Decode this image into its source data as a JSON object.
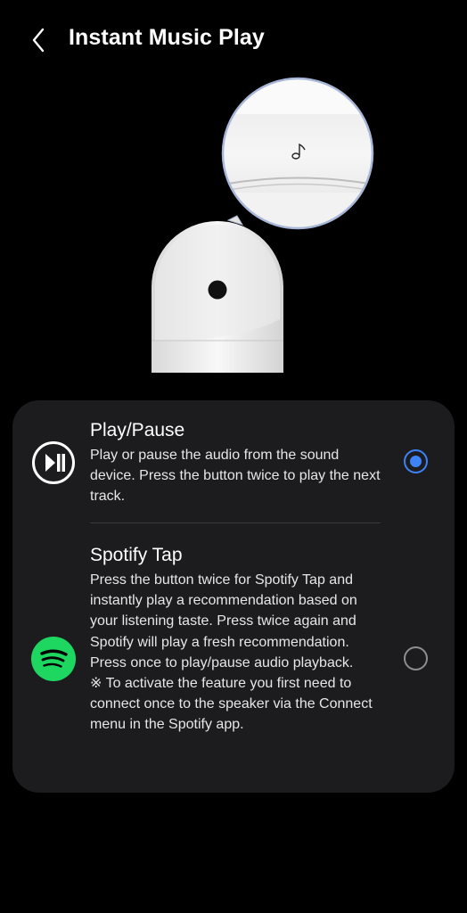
{
  "header": {
    "title": "Instant Music Play",
    "back_icon": "chevron-left-icon"
  },
  "illustration": {
    "device_icon": "music-note-icon"
  },
  "options": [
    {
      "title": "Play/Pause",
      "description": "Play or pause the audio from the sound device. Press the button twice to play the next track.",
      "icon": "play-pause-icon",
      "selected": true
    },
    {
      "title": "Spotify Tap",
      "description": "Press the button twice for Spotify Tap and instantly play a recommendation based on your listening taste. Press twice again and Spotify will play a fresh recommendation.\nPress once to play/pause audio playback.\n※ To activate the feature you first need to connect once to the speaker via the Connect menu in the Spotify app.",
      "icon": "spotify-icon",
      "selected": false
    }
  ],
  "colors": {
    "background": "#000000",
    "card": "#1c1c1e",
    "accent": "#3e82f7",
    "spotify_green": "#1ed760"
  }
}
